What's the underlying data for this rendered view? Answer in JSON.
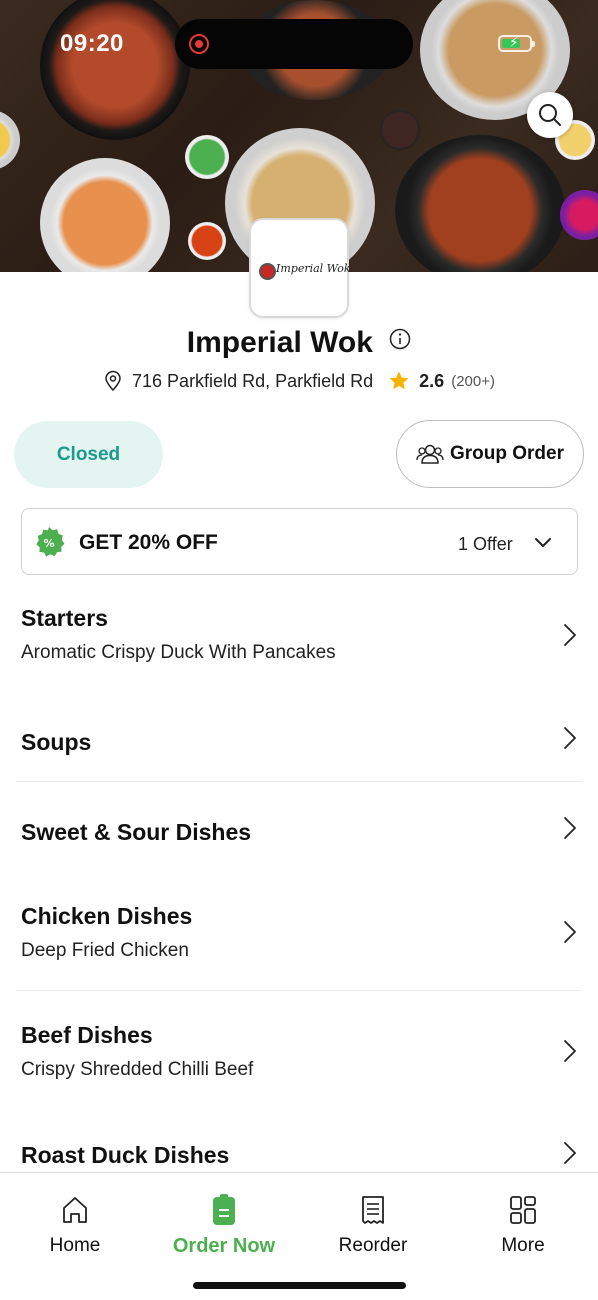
{
  "status_bar": {
    "time": "09:20",
    "battery_charging": true,
    "battery_level": 0.7
  },
  "header": {
    "search_icon": "search-icon"
  },
  "restaurant": {
    "logo_text": "Imperial Wok",
    "name": "Imperial Wok",
    "address": "716 Parkfield Rd, Parkfield Rd",
    "rating": "2.6",
    "rating_count": "(200+)"
  },
  "actions": {
    "closed_label": "Closed",
    "group_order_label": "Group Order"
  },
  "offer": {
    "title": "GET 20% OFF",
    "count_label": "1 Offer"
  },
  "menu": {
    "categories": [
      {
        "title": "Starters",
        "subtitle": "Aromatic Crispy Duck With Pancakes"
      },
      {
        "title": "Soups",
        "subtitle": ""
      },
      {
        "title": "Sweet & Sour Dishes",
        "subtitle": ""
      },
      {
        "title": "Chicken Dishes",
        "subtitle": "Deep Fried Chicken"
      },
      {
        "title": "Beef Dishes",
        "subtitle": "Crispy Shredded Chilli Beef"
      },
      {
        "title": "Roast Duck Dishes",
        "subtitle": ""
      }
    ]
  },
  "bottom_nav": {
    "items": [
      {
        "label": "Home",
        "icon": "home-icon",
        "active": false
      },
      {
        "label": "Order Now",
        "icon": "order-icon",
        "active": true
      },
      {
        "label": "Reorder",
        "icon": "receipt-icon",
        "active": false
      },
      {
        "label": "More",
        "icon": "grid-icon",
        "active": false
      }
    ]
  },
  "colors": {
    "accent_green": "#4caf50",
    "closed_teal": "#1b9b8b",
    "closed_bg": "#e3f4f1",
    "star": "#f5b400"
  }
}
